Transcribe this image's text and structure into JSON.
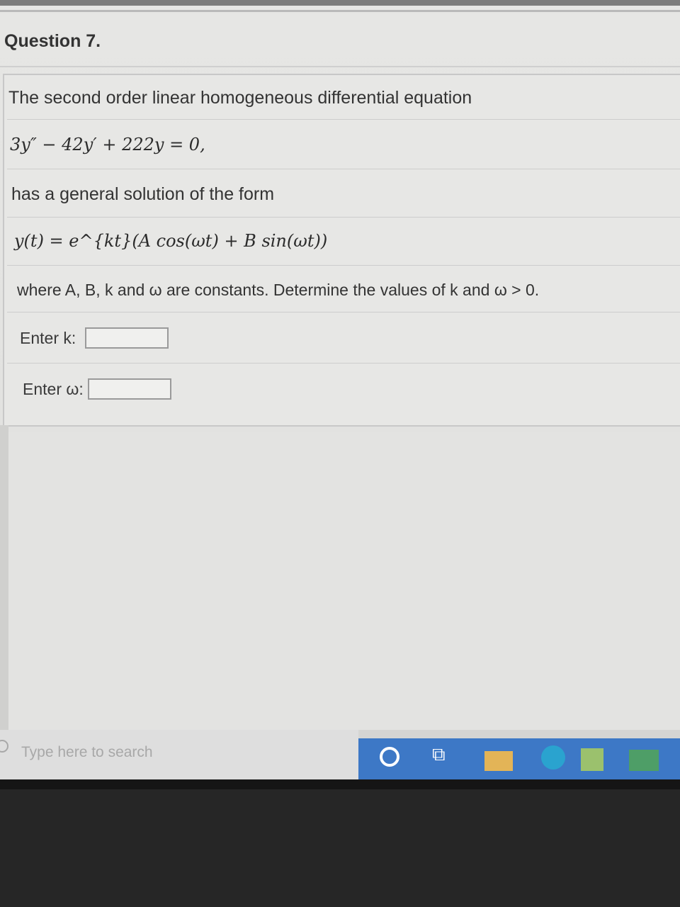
{
  "question": {
    "title": "Question 7.",
    "line1": "The second order linear homogeneous differential equation",
    "equation": "3y″ − 42y′ + 222y = 0,",
    "line3": "has a general solution of the form",
    "solution_form": "y(t) = e^{kt}(A cos(ωt) + B sin(ωt))",
    "line5": "where A, B, k and ω are constants. Determine the values of k and ω > 0."
  },
  "inputs": {
    "k_label": "Enter k:",
    "k_value": "",
    "w_label": "Enter ω:",
    "w_value": ""
  },
  "taskbar": {
    "search_placeholder": "Type here to search",
    "icons": [
      "cortana-icon",
      "task-view-icon",
      "file-explorer-icon",
      "edge-icon",
      "store-icon",
      "mail-icon"
    ]
  }
}
